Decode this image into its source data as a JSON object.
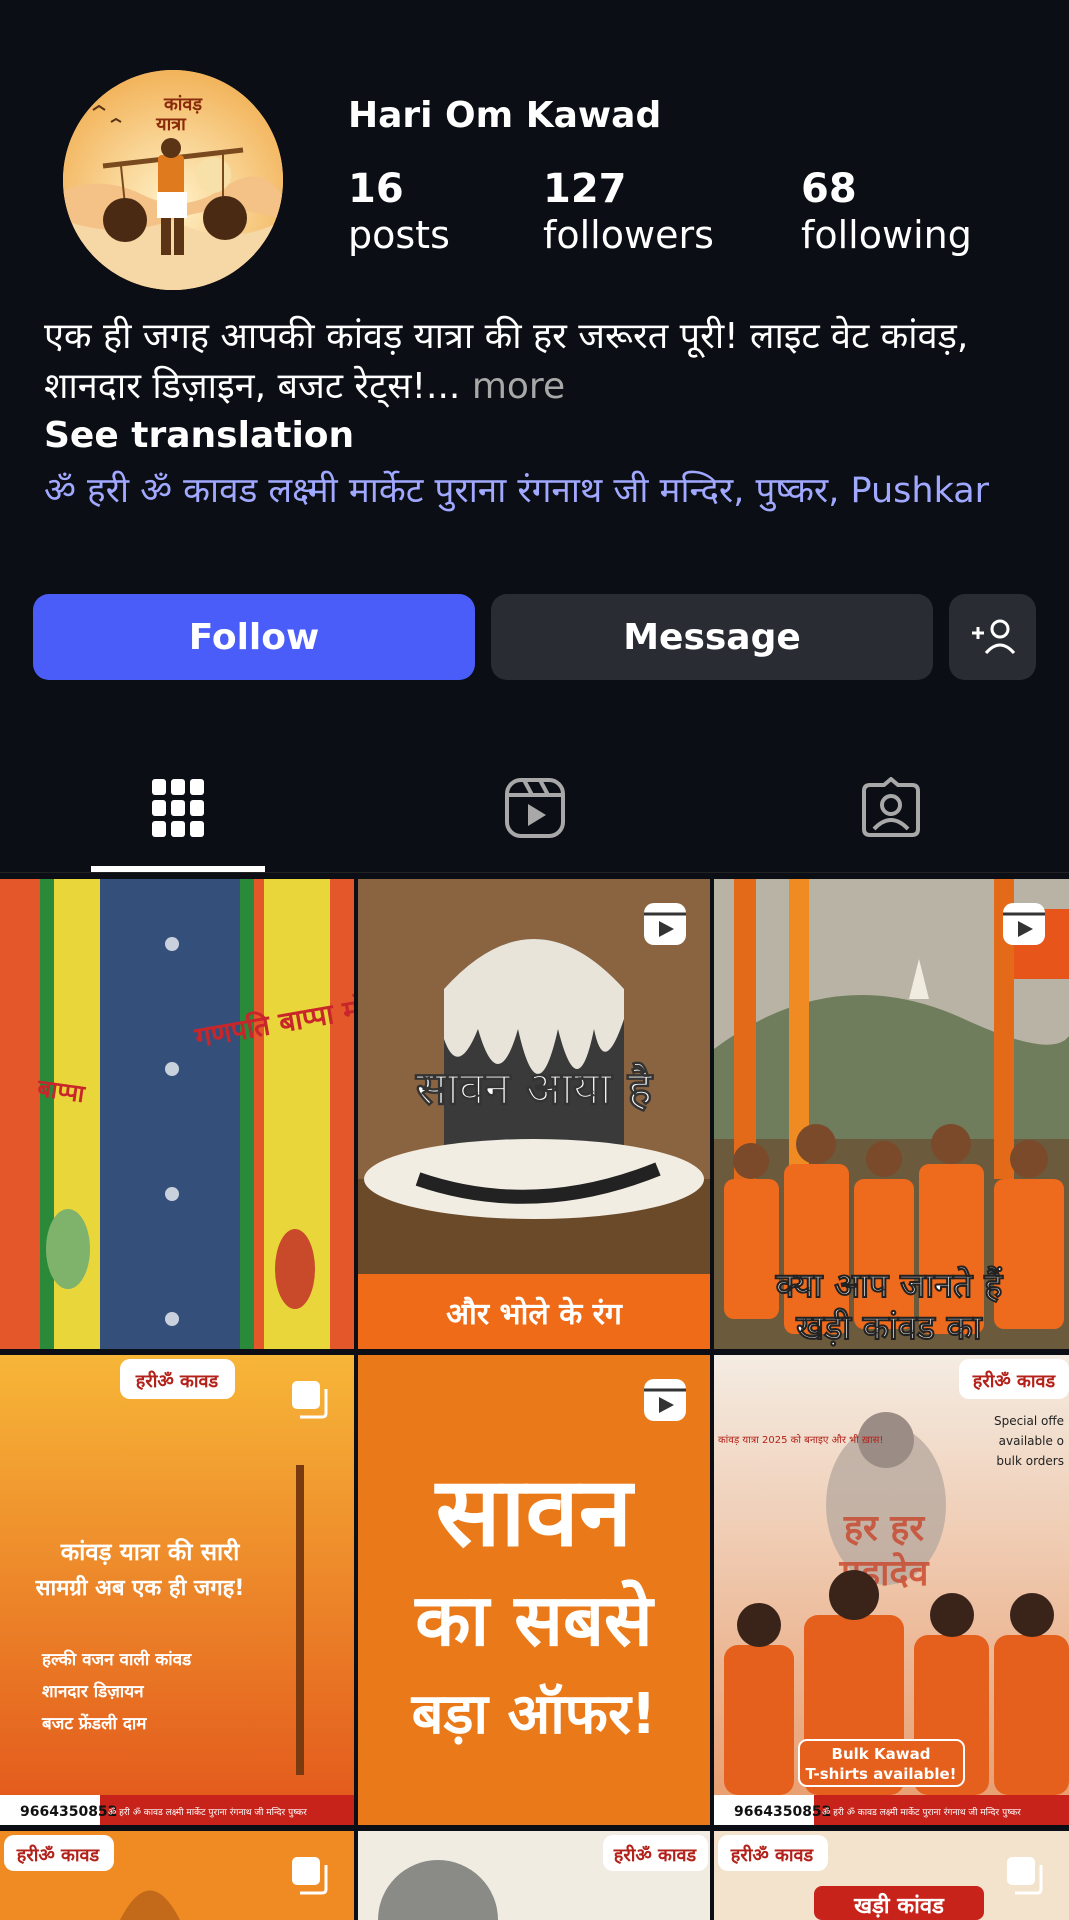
{
  "profile": {
    "username": "Hari Om Kawad",
    "posts_count": "16",
    "posts_label": "posts",
    "followers_count": "127",
    "followers_label": "followers",
    "following_count": "68",
    "following_label": "following",
    "bio_text": "एक ही जगह आपकी कांवड़ यात्रा की हर जरूरत पूरी! लाइट वेट कांवड़, शानदार डिज़ाइन, बजट रेट्स!...",
    "bio_more": " more",
    "see_translation": "See translation",
    "address": "ॐ हरी ॐ कावड लक्ष्मी मार्केट पुराना रंगनाथ जी मन्दिर, पुष्कर, Pushkar",
    "avatar_text_1": "कांवड़",
    "avatar_text_2": "यात्रा"
  },
  "actions": {
    "follow_label": "Follow",
    "message_label": "Message",
    "add_user_icon": "add-user-icon"
  },
  "tabs": [
    {
      "icon": "grid-icon",
      "active": true
    },
    {
      "icon": "reels-icon",
      "active": false
    },
    {
      "icon": "tagged-icon",
      "active": false
    }
  ],
  "colors": {
    "background": "#0b0e14",
    "follow_button": "#4a5df9",
    "secondary_button": "#2a2c33",
    "address_link": "#a0a8ff"
  },
  "posts": [
    {
      "type": "photo",
      "text_1": "गणपति बाप्पा मोरया"
    },
    {
      "type": "reel",
      "text_1": "सावन आया है",
      "text_2": "और भोले के रंग"
    },
    {
      "type": "reel",
      "text_1": "क्या आप जानते हैं",
      "text_2": "खड़ी कांवड का"
    },
    {
      "type": "carousel",
      "brand": "हरीॐ कावड",
      "text_1": "कांवड़ यात्रा की सारी",
      "text_2": "सामग्री अब एक ही जगह!",
      "bullets": [
        "हल्की वजन वाली कांवड",
        "शानदार डिज़ायन",
        "बजट फ्रेंडली दाम"
      ],
      "phone": "9664350852",
      "address": "ॐ हरी ॐ कावड लक्ष्मी मार्केट पुराना रंगनाथ जी मन्दिर पुष्कर"
    },
    {
      "type": "reel",
      "text_1": "सावन",
      "text_2": "का सबसे",
      "text_3": "बड़ा ऑफर!"
    },
    {
      "type": "photo",
      "brand": "हरीॐ कावड",
      "text_1": "हर हर",
      "text_2": "महादेव",
      "side_1": "Special offe",
      "side_2": "available o",
      "side_3": "bulk orders",
      "top_note": "कांवड़ यात्रा 2025 को बनाइए और भी ख़ास!",
      "badge_1": "Bulk Kawad",
      "badge_2": "T-shirts available!",
      "phone": "9664350852",
      "address": "ॐ हरी ॐ कावड लक्ष्मी मार्केट पुराना रंगनाथ जी मन्दिर पुष्कर"
    },
    {
      "type": "carousel",
      "brand": "हरीॐ कावड"
    },
    {
      "type": "photo",
      "brand": "हरीॐ कावड"
    },
    {
      "type": "carousel",
      "brand": "हरीॐ कावड",
      "text_1": "खड़ी कांवड"
    }
  ]
}
